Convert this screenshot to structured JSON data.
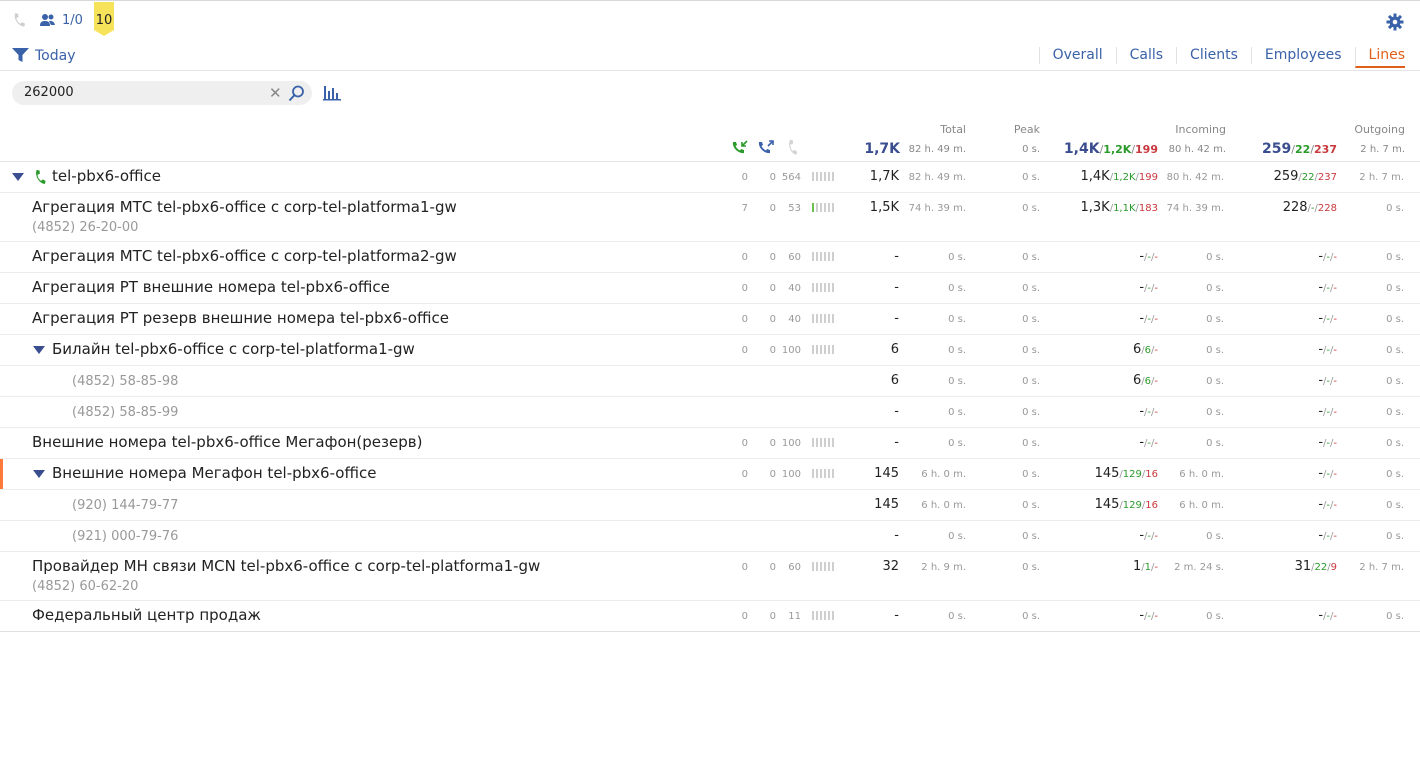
{
  "topbar": {
    "operators_count": "1/0",
    "badge": "10"
  },
  "filter": {
    "label": "Today"
  },
  "tabs": [
    "Overall",
    "Calls",
    "Clients",
    "Employees",
    "Lines"
  ],
  "active_tab": "Lines",
  "search": {
    "value": "262000"
  },
  "columns": {
    "total": "Total",
    "peak": "Peak",
    "incoming": "Incoming",
    "outgoing": "Outgoing"
  },
  "summary": {
    "total": "1,7K",
    "total_time": "82 h. 49 m.",
    "peak": "0 s.",
    "in_total": "1,4K",
    "in_ok": "1,2K",
    "in_miss": "199",
    "in_time": "80 h. 42 m.",
    "out_total": "259",
    "out_ok": "22",
    "out_miss": "237",
    "out_time": "2 h. 7 m."
  },
  "rows": [
    {
      "name": "tel-pbx6-office",
      "kind": "root",
      "c1": "0",
      "c2": "0",
      "c3": "564",
      "green_bars": 0,
      "total": "1,7K",
      "total_time": "82 h. 49 m.",
      "peak": "0 s.",
      "in_total": "1,4K",
      "in_ok": "1,2K",
      "in_miss": "199",
      "in_time": "80 h. 42 m.",
      "out_total": "259",
      "out_ok": "22",
      "out_miss": "237",
      "out_time": "2 h. 7 m."
    },
    {
      "name": "Агрегация МТС tel-pbx6-office с corp-tel-platforma1-gw",
      "sub": "(4852) 26-20-00",
      "kind": "line",
      "c1": "7",
      "c2": "0",
      "c3": "53",
      "green_bars": 1,
      "total": "1,5K",
      "total_time": "74 h. 39 m.",
      "peak": "0 s.",
      "in_total": "1,3K",
      "in_ok": "1,1K",
      "in_miss": "183",
      "in_time": "74 h. 39 m.",
      "out_total": "228",
      "out_ok": "-",
      "out_miss": "228",
      "out_time": "0 s."
    },
    {
      "name": "Агрегация МТС tel-pbx6-office с corp-tel-platforma2-gw",
      "kind": "line",
      "c1": "0",
      "c2": "0",
      "c3": "60",
      "green_bars": 0,
      "total": "-",
      "total_time": "0 s.",
      "peak": "0 s.",
      "in_total": "-",
      "in_ok": "-",
      "in_miss": "-",
      "in_time": "0 s.",
      "out_total": "-",
      "out_ok": "-",
      "out_miss": "-",
      "out_time": "0 s."
    },
    {
      "name": "Агрегация РТ внешние номера tel-pbx6-office",
      "kind": "line",
      "c1": "0",
      "c2": "0",
      "c3": "40",
      "green_bars": 0,
      "total": "-",
      "total_time": "0 s.",
      "peak": "0 s.",
      "in_total": "-",
      "in_ok": "-",
      "in_miss": "-",
      "in_time": "0 s.",
      "out_total": "-",
      "out_ok": "-",
      "out_miss": "-",
      "out_time": "0 s."
    },
    {
      "name": "Агрегация РТ резерв внешние номера tel-pbx6-office",
      "kind": "line",
      "c1": "0",
      "c2": "0",
      "c3": "40",
      "green_bars": 0,
      "total": "-",
      "total_time": "0 s.",
      "peak": "0 s.",
      "in_total": "-",
      "in_ok": "-",
      "in_miss": "-",
      "in_time": "0 s.",
      "out_total": "-",
      "out_ok": "-",
      "out_miss": "-",
      "out_time": "0 s."
    },
    {
      "name": "Билайн tel-pbx6-office с corp-tel-platforma1-gw",
      "kind": "group",
      "c1": "0",
      "c2": "0",
      "c3": "100",
      "green_bars": 0,
      "total": "6",
      "total_time": "0 s.",
      "peak": "0 s.",
      "in_total": "6",
      "in_ok": "6",
      "in_miss": "-",
      "in_time": "0 s.",
      "out_total": "-",
      "out_ok": "-",
      "out_miss": "-",
      "out_time": "0 s."
    },
    {
      "name": "(4852) 58-85-98",
      "kind": "phone",
      "total": "6",
      "total_time": "0 s.",
      "peak": "0 s.",
      "in_total": "6",
      "in_ok": "6",
      "in_miss": "-",
      "in_time": "0 s.",
      "out_total": "-",
      "out_ok": "-",
      "out_miss": "-",
      "out_time": "0 s."
    },
    {
      "name": "(4852) 58-85-99",
      "kind": "phone",
      "total": "-",
      "total_time": "0 s.",
      "peak": "0 s.",
      "in_total": "-",
      "in_ok": "-",
      "in_miss": "-",
      "in_time": "0 s.",
      "out_total": "-",
      "out_ok": "-",
      "out_miss": "-",
      "out_time": "0 s."
    },
    {
      "name": "Внешние номера tel-pbx6-office Мегафон(резерв)",
      "kind": "line",
      "c1": "0",
      "c2": "0",
      "c3": "100",
      "green_bars": 0,
      "total": "-",
      "total_time": "0 s.",
      "peak": "0 s.",
      "in_total": "-",
      "in_ok": "-",
      "in_miss": "-",
      "in_time": "0 s.",
      "out_total": "-",
      "out_ok": "-",
      "out_miss": "-",
      "out_time": "0 s."
    },
    {
      "name": "Внешние номера Мегафон tel-pbx6-office",
      "kind": "group",
      "marked": true,
      "c1": "0",
      "c2": "0",
      "c3": "100",
      "green_bars": 0,
      "total": "145",
      "total_time": "6 h. 0 m.",
      "peak": "0 s.",
      "in_total": "145",
      "in_ok": "129",
      "in_miss": "16",
      "in_time": "6 h. 0 m.",
      "out_total": "-",
      "out_ok": "-",
      "out_miss": "-",
      "out_time": "0 s."
    },
    {
      "name": "(920) 144-79-77",
      "kind": "phone",
      "total": "145",
      "total_time": "6 h. 0 m.",
      "peak": "0 s.",
      "in_total": "145",
      "in_ok": "129",
      "in_miss": "16",
      "in_time": "6 h. 0 m.",
      "out_total": "-",
      "out_ok": "-",
      "out_miss": "-",
      "out_time": "0 s."
    },
    {
      "name": "(921) 000-79-76",
      "kind": "phone",
      "total": "-",
      "total_time": "0 s.",
      "peak": "0 s.",
      "in_total": "-",
      "in_ok": "-",
      "in_miss": "-",
      "in_time": "0 s.",
      "out_total": "-",
      "out_ok": "-",
      "out_miss": "-",
      "out_time": "0 s."
    },
    {
      "name": "Провайдер МН связи MCN tel-pbx6-office с corp-tel-platforma1-gw",
      "sub": "(4852) 60-62-20",
      "kind": "line",
      "c1": "0",
      "c2": "0",
      "c3": "60",
      "green_bars": 0,
      "total": "32",
      "total_time": "2 h. 9 m.",
      "peak": "0 s.",
      "in_total": "1",
      "in_ok": "1",
      "in_miss": "-",
      "in_time": "2 m. 24 s.",
      "out_total": "31",
      "out_ok": "22",
      "out_miss": "9",
      "out_time": "2 h. 7 m."
    },
    {
      "name": "Федеральный центр продаж",
      "kind": "line",
      "c1": "0",
      "c2": "0",
      "c3": "11",
      "green_bars": 0,
      "total": "-",
      "total_time": "0 s.",
      "peak": "0 s.",
      "in_total": "-",
      "in_ok": "-",
      "in_miss": "-",
      "in_time": "0 s.",
      "out_total": "-",
      "out_ok": "-",
      "out_miss": "-",
      "out_time": "0 s."
    }
  ],
  "colors": {
    "accent": "#3a62a8",
    "active_tab": "#e0601a",
    "ok": "#2a9a2a",
    "miss": "#c8383c",
    "badge": "#f7e35a",
    "marker": "#ff7a3a"
  },
  "icons": [
    "phone-icon",
    "operators-icon",
    "gear-icon",
    "filter-icon",
    "close-icon",
    "search-icon",
    "bar-chart-icon",
    "incoming-call-icon",
    "outgoing-call-icon",
    "expand-triangle-icon"
  ]
}
